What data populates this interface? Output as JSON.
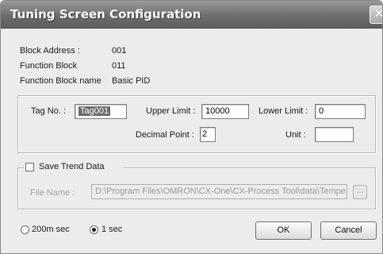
{
  "window": {
    "title": "Tuning Screen Configuration",
    "close_glyph": "✕"
  },
  "info": {
    "block_address_label": "Block Address :",
    "block_address_value": "001",
    "function_block_label": "Function Block",
    "function_block_value": "011",
    "function_block_name_label": "Function Block name",
    "function_block_name_value": "Basic PID"
  },
  "tag_group": {
    "tag_no_label": "Tag No. :",
    "tag_no_value": "Tag001",
    "upper_limit_label": "Upper Limit :",
    "upper_limit_value": "10000",
    "lower_limit_label": "Lower Limit :",
    "lower_limit_value": "0",
    "decimal_point_label": "Decimal Point :",
    "decimal_point_value": "2",
    "unit_label": "Unit :",
    "unit_value": ""
  },
  "trend": {
    "save_trend_label": "Save Trend Data",
    "save_trend_checked": false,
    "file_name_label": "File Name :",
    "file_name_value": "D:\\Program Files\\OMRON\\CX-One\\CX-Process Tool\\data\\Tempe",
    "browse_label": "..."
  },
  "interval": {
    "option_200ms": "200m sec",
    "option_1s": "1 sec",
    "selected": "1 sec"
  },
  "buttons": {
    "ok": "OK",
    "cancel": "Cancel"
  },
  "icons": {
    "close": "close-icon",
    "browse": "ellipsis-icon"
  },
  "colors": {
    "titlebar": "#6e6e6e",
    "background": "#ececec",
    "selection": "#6b6b6b"
  }
}
